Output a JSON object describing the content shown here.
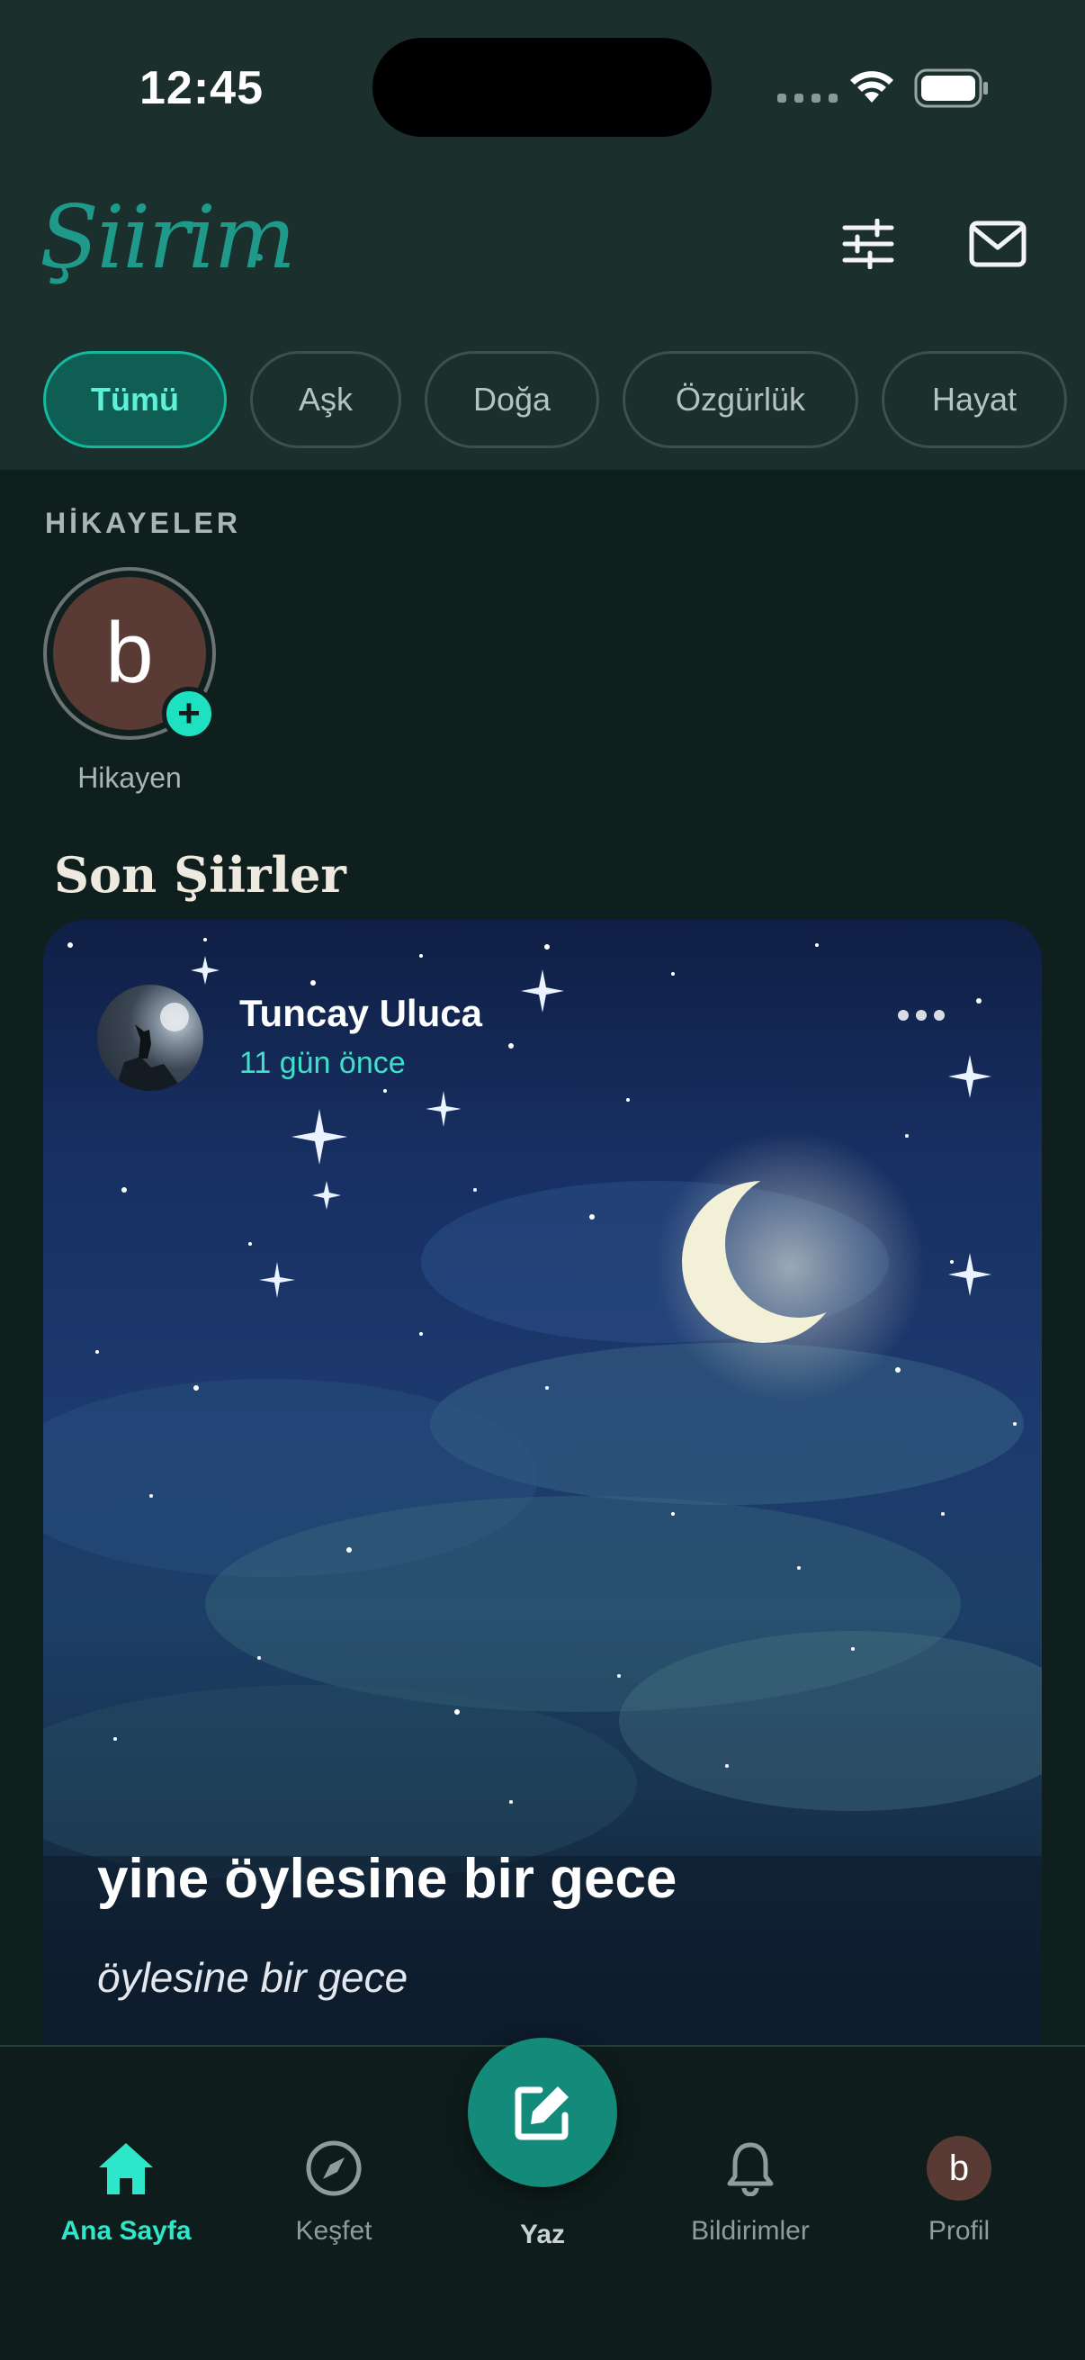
{
  "status_bar": {
    "time": "12:45"
  },
  "header": {
    "logo": "Şiirim",
    "filters_icon": "sliders-icon",
    "messages_icon": "mail-icon"
  },
  "categories": [
    {
      "label": "Tümü",
      "active": true
    },
    {
      "label": "Aşk",
      "active": false
    },
    {
      "label": "Doğa",
      "active": false
    },
    {
      "label": "Özgürlük",
      "active": false
    },
    {
      "label": "Hayat",
      "active": false
    }
  ],
  "stories": {
    "title": "HİKAYELER",
    "own": {
      "initial": "b",
      "label": "Hikayen",
      "add_icon": "plus-icon"
    }
  },
  "feed": {
    "section_title": "Son Şiirler",
    "posts": [
      {
        "author": "Tuncay Uluca",
        "time_ago": "11 gün önce",
        "title": "yine öylesine bir gece",
        "excerpt": "öylesine bir gece",
        "more_icon": "ellipsis-icon"
      }
    ]
  },
  "tabbar": {
    "items": [
      {
        "label": "Ana Sayfa",
        "icon": "home-icon",
        "active": true
      },
      {
        "label": "Keşfet",
        "icon": "compass-icon",
        "active": false
      },
      {
        "label": "Yaz",
        "icon": "edit-icon",
        "active": false
      },
      {
        "label": "Bildirimler",
        "icon": "bell-icon",
        "active": false
      },
      {
        "label": "Profil",
        "icon": "avatar",
        "initial": "b",
        "active": false
      }
    ]
  },
  "colors": {
    "accent": "#2ee6c9",
    "header_bg": "#1b302d",
    "page_bg": "#0f1f1d",
    "avatar_bg": "#5a3a34"
  }
}
